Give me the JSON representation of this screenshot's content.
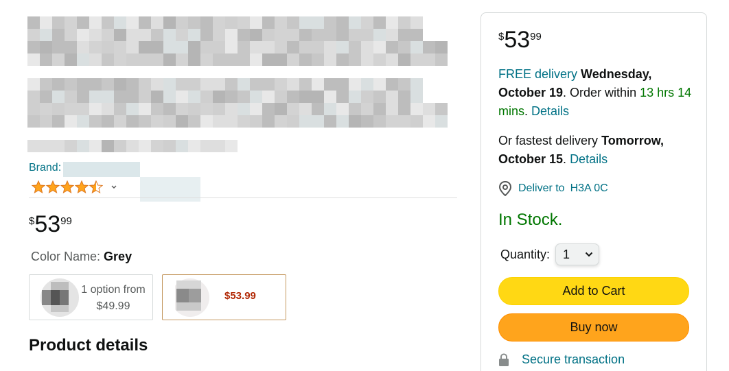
{
  "product": {
    "brand_label": "Brand:",
    "rating_value": 4.5,
    "rating_max": 5,
    "price": {
      "currency": "$",
      "whole": "53",
      "fraction": "99"
    },
    "color_label": "Color Name:",
    "color_value": "Grey",
    "options": [
      {
        "line1": "1 option from",
        "line2": "$49.99",
        "selected": false
      },
      {
        "price": "$53.99",
        "selected": true
      }
    ],
    "section_title": "Product details"
  },
  "buybox": {
    "price": {
      "currency": "$",
      "whole": "53",
      "fraction": "99"
    },
    "delivery": {
      "free_label": "FREE delivery",
      "date": "Wednesday, October 19",
      "order_within_prefix": ". Order within",
      "order_within": "13 hrs 14 mins",
      "details": "Details"
    },
    "fastest": {
      "prefix": "Or fastest delivery",
      "date": "Tomorrow, October 15",
      "details": "Details"
    },
    "deliver_to_label": "Deliver to",
    "deliver_to_zip": "H3A 0C",
    "stock": "In Stock.",
    "quantity_label": "Quantity:",
    "quantity_value": "1",
    "add_to_cart": "Add to Cart",
    "buy_now": "Buy now",
    "secure": "Secure transaction"
  },
  "colors": {
    "link": "#007185",
    "green": "#007600",
    "cart_yellow": "#ffd814",
    "buy_orange": "#ffa41c",
    "price_red": "#b12704",
    "star": "#ffa41c"
  }
}
